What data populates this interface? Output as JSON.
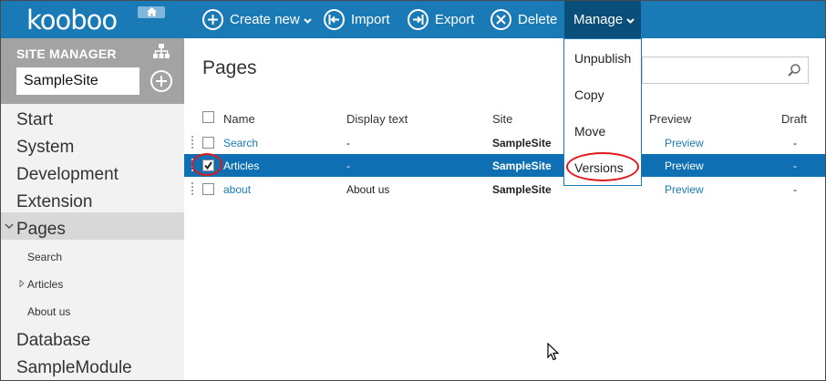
{
  "brand": {
    "logo": "kooboo"
  },
  "toolbar": {
    "create_new": "Create new",
    "import": "Import",
    "export": "Export",
    "delete": "Delete",
    "manage": "Manage"
  },
  "manage_menu": {
    "items": [
      "Unpublish",
      "Copy",
      "Move",
      "Versions"
    ]
  },
  "sidebar": {
    "title": "SITE MANAGER",
    "site_value": "SampleSite",
    "items": [
      "Start",
      "System",
      "Development",
      "Extension",
      "Pages",
      "Database",
      "SampleModule"
    ],
    "sub_items": [
      "Search",
      "Articles",
      "About us"
    ]
  },
  "main": {
    "title": "Pages",
    "search_placeholder": "",
    "columns": [
      "Name",
      "Display text",
      "Site",
      "Preview",
      "Draft"
    ],
    "rows": [
      {
        "name": "Search",
        "display_text": "-",
        "site": "SampleSite",
        "preview": "Preview",
        "draft": "-",
        "selected": false
      },
      {
        "name": "Articles",
        "display_text": "-",
        "site": "SampleSite",
        "preview": "Preview",
        "draft": "-",
        "selected": true
      },
      {
        "name": "about",
        "display_text": "About us",
        "site": "SampleSite",
        "preview": "Preview",
        "draft": "-",
        "selected": false
      }
    ]
  },
  "colors": {
    "toolbar": "#1a7ab5",
    "manage_active": "#0a4f7a",
    "selected_row": "#0e70b2",
    "highlight_ring": "#e0191d"
  }
}
